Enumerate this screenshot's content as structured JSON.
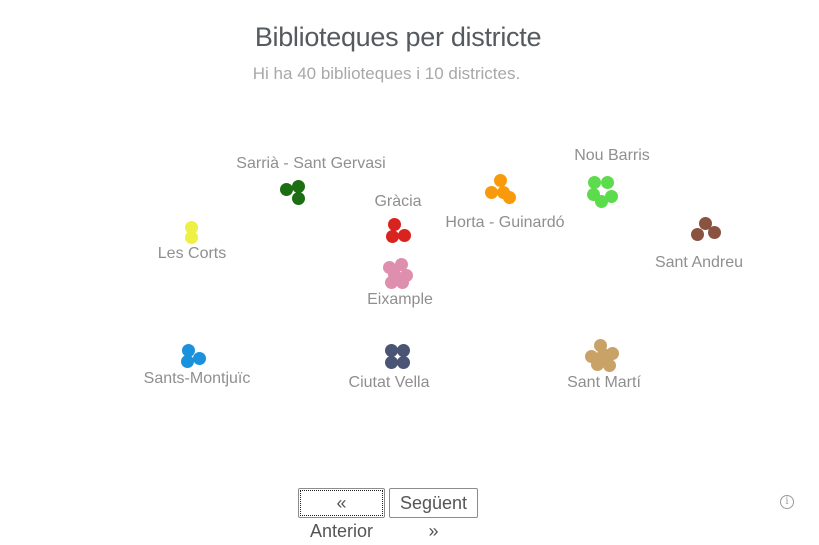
{
  "header": {
    "title": "Biblioteques per districte",
    "subtitle": "Hi ha 40 biblioteques i 10 districtes."
  },
  "districts": [
    {
      "name": "Sarrià - Sant Gervasi",
      "color": "#1b6e12",
      "count": 3
    },
    {
      "name": "Gràcia",
      "color": "#d9231e",
      "count": 3
    },
    {
      "name": "Horta - Guinardó",
      "color": "#f89a0c",
      "count": 4
    },
    {
      "name": "Nou Barris",
      "color": "#5cdc4c",
      "count": 5
    },
    {
      "name": "Les Corts",
      "color": "#eef043",
      "count": 2
    },
    {
      "name": "Eixample",
      "color": "#df8fae",
      "count": 6
    },
    {
      "name": "Sant Andreu",
      "color": "#8a5340",
      "count": 3
    },
    {
      "name": "Sants-Montjuïc",
      "color": "#1a91dc",
      "count": 3
    },
    {
      "name": "Ciutat Vella",
      "color": "#4a5575",
      "count": 4
    },
    {
      "name": "Sant Martí",
      "color": "#c8a267",
      "count": 7
    }
  ],
  "nav": {
    "prev_label": "« Anterior",
    "next_label": "Següent »"
  },
  "footer": {
    "info_icon": "info-icon",
    "info_glyph": "i"
  }
}
